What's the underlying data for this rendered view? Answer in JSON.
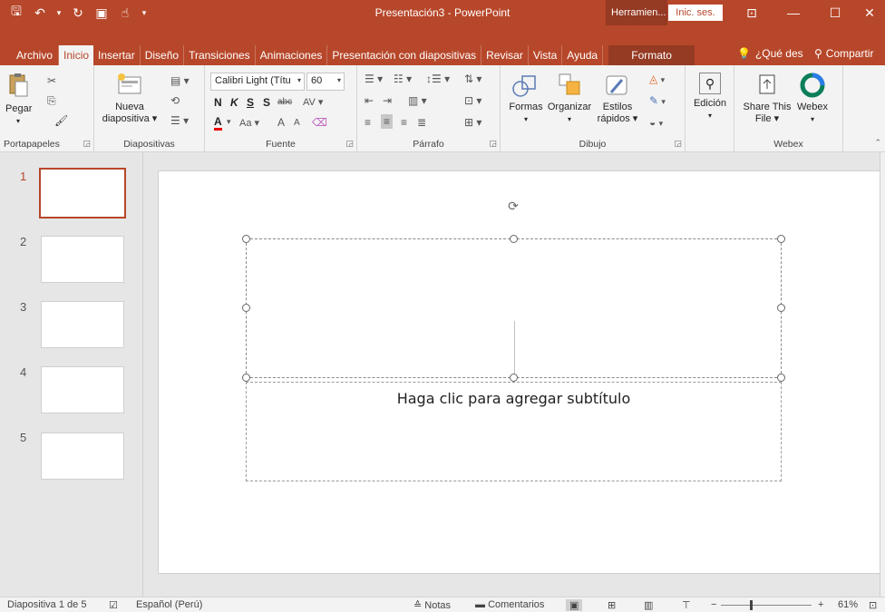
{
  "window": {
    "title": "Presentación3  -  PowerPoint",
    "context_title": "Herramien...",
    "signin": "Inic. ses.",
    "minimize": "—",
    "maximize": "☐",
    "close": "✕",
    "restore_ribbon": "⊡"
  },
  "qat": {
    "save": "🖫",
    "undo": "↶",
    "redo": "↻",
    "presenter": "▣",
    "touch": "☝",
    "customize": "▾"
  },
  "tabs": [
    "Archivo",
    "Inicio",
    "Insertar",
    "Diseño",
    "Transiciones",
    "Animaciones",
    "Presentación con diapositivas",
    "Revisar",
    "Vista",
    "Ayuda",
    "Formato"
  ],
  "active_tab": "Inicio",
  "context_tab": "Formato",
  "tellme": "¿Qué des",
  "share": "Compartir",
  "ribbon": {
    "portapapeles": {
      "label": "Portapapeles",
      "paste": "Pegar"
    },
    "diapositivas": {
      "label": "Diapositivas",
      "new_slide_1": "Nueva",
      "new_slide_2": "diapositiva"
    },
    "fuente": {
      "label": "Fuente",
      "font_name": "Calibri Light (Títu",
      "font_size": "60",
      "bold": "N",
      "italic": "K",
      "underline": "S",
      "shadow": "S",
      "strike": "abc",
      "spacing": "AV",
      "font_color": "A",
      "change_case": "Aa",
      "grow": "A",
      "shrink": "A"
    },
    "parrafo": {
      "label": "Párrafo"
    },
    "dibujo": {
      "label": "Dibujo",
      "shapes": "Formas",
      "arrange": "Organizar",
      "quick_styles_1": "Estilos",
      "quick_styles_2": "rápidos"
    },
    "edicion": {
      "label": "Edición"
    },
    "webex": {
      "label": "Webex",
      "share_this_1": "Share This",
      "share_this_2": "File",
      "webex": "Webex"
    }
  },
  "thumbnails": [
    "1",
    "2",
    "3",
    "4",
    "5"
  ],
  "slide": {
    "subtitle_placeholder": "Haga clic para agregar subtítulo"
  },
  "status": {
    "slide_of": "Diapositiva 1 de 5",
    "language": "Español (Perú)",
    "notes": "Notas",
    "comments": "Comentarios",
    "zoom": "61%",
    "zoom_minus": "−",
    "zoom_plus": "+"
  },
  "colors": {
    "accent": "#b7472a",
    "context": "#953a23"
  }
}
